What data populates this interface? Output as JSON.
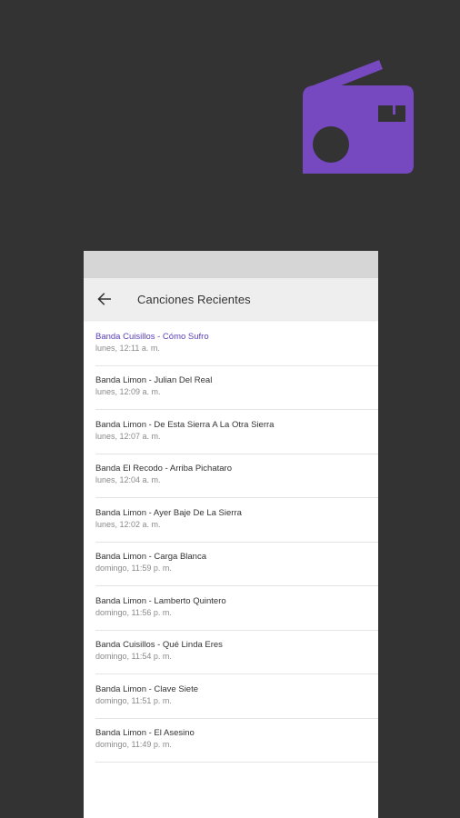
{
  "colors": {
    "background": "#333333",
    "accent": "#7749c0",
    "active_text": "#5a3fb8"
  },
  "logo": {
    "icon": "radio-icon"
  },
  "app_bar": {
    "back_icon": "arrow-back-icon",
    "title": "Canciones Recientes"
  },
  "songs": [
    {
      "title": "Banda Cuisillos - Cómo Sufro",
      "time": "lunes, 12:11 a. m."
    },
    {
      "title": "Banda Limon - Julian Del Real",
      "time": "lunes, 12:09 a. m."
    },
    {
      "title": "Banda Limon - De Esta Sierra A La Otra Sierra",
      "time": "lunes, 12:07 a. m."
    },
    {
      "title": "Banda El Recodo - Arriba Pichataro",
      "time": "lunes, 12:04 a. m."
    },
    {
      "title": "Banda Limon - Ayer Baje De La Sierra",
      "time": "lunes, 12:02 a. m."
    },
    {
      "title": "Banda Limon - Carga Blanca",
      "time": "domingo, 11:59 p. m."
    },
    {
      "title": "Banda Limon - Lamberto Quintero",
      "time": "domingo, 11:56 p. m."
    },
    {
      "title": "Banda Cuisillos - Qué Linda Eres",
      "time": "domingo, 11:54 p. m."
    },
    {
      "title": "Banda Limon - Clave Siete",
      "time": "domingo, 11:51 p. m."
    },
    {
      "title": "Banda Limon - El Asesino",
      "time": "domingo, 11:49 p. m."
    }
  ]
}
